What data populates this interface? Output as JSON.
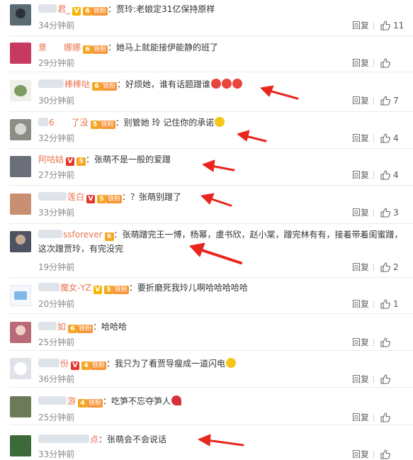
{
  "actions": {
    "reply_label": "回复"
  },
  "colors": {
    "username": "#eb7350",
    "arrow": "#e8261d",
    "time": "#8a8a8a"
  },
  "comments": [
    {
      "username": "君_",
      "badge": "gold",
      "level": "6",
      "fan_badge": "铁粉",
      "text": "：贾玲:老娘定31亿保持原样",
      "time": "34分钟前",
      "likes": "11",
      "avatar_color": "#5c6a73"
    },
    {
      "username": "意　　娜娜",
      "badge": "",
      "level": "6",
      "fan_badge": "铁粉",
      "text": "：她马上就能接伊能静的班了",
      "time": "29分钟前",
      "likes": "",
      "avatar_color": "#c63a62"
    },
    {
      "username": "棒棒哒",
      "badge": "",
      "level": "6",
      "fan_badge": "铁粉",
      "text": "：好烦她，谁有话题蹭谁",
      "time": "30分钟前",
      "likes": "7",
      "avatar_color": "#7f9a62",
      "emoji": [
        "angry-face-icon",
        "angry-face-icon",
        "angry-face-icon"
      ]
    },
    {
      "username": "6　　了没",
      "badge": "",
      "level": "5",
      "fan_badge": "铁粉",
      "text": "：别管她  玲  记住你的承诺",
      "time": "32分钟前",
      "likes": "4",
      "avatar_color": "#8c8d86",
      "emoji": [
        "cool-face-icon"
      ]
    },
    {
      "username": "阿咕姑",
      "badge": "red",
      "level": "5",
      "fan_badge": "",
      "text": "：张萌不是一般的爱蹭",
      "time": "27分钟前",
      "likes": "4",
      "avatar_color": "#6a6f7a"
    },
    {
      "username": "莲白",
      "badge": "red",
      "level": "5",
      "fan_badge": "铁粉",
      "text": "：？张萌别蹭了",
      "time": "33分钟前",
      "likes": "3",
      "avatar_color": "#c98f72"
    },
    {
      "username": "ssforever",
      "badge": "",
      "level": "6",
      "fan_badge": "",
      "text": "：张萌蹭完王一博，杨幂，虞书欣，赵小棠，蹭完林有有，接着带着闺蜜蹭，这次蹭贾玲，有完没完",
      "time": "19分钟前",
      "likes": "2",
      "avatar_color": "#4d5360"
    },
    {
      "username": "魔女-YZ",
      "badge": "gold",
      "level": "5",
      "fan_badge": "铁粉",
      "text": "：要折磨死我玲儿啊哈哈哈哈哈",
      "time": "20分钟前",
      "likes": "1",
      "avatar_color": "#7fb8e8"
    },
    {
      "username": "如",
      "badge": "",
      "level": "6",
      "fan_badge": "铁粉",
      "text": "：哈哈哈",
      "time": "25分钟前",
      "likes": "",
      "avatar_color": "#b86a78"
    },
    {
      "username": "份",
      "badge": "red",
      "level": "4",
      "fan_badge": "铁粉",
      "text": "：我只为了看贾导瘦成一道闪电",
      "time": "36分钟前",
      "likes": "",
      "avatar_color": "#dfe2e6",
      "emoji": [
        "laughing-face-icon"
      ]
    },
    {
      "username": "游",
      "badge": "",
      "level": "4",
      "fan_badge": "铁粉",
      "text": "：吃笋不忘夺笋人",
      "time": "25分钟前",
      "likes": "",
      "avatar_color": "#6b7b5a",
      "emoji": [
        "rose-icon"
      ]
    },
    {
      "username": "点",
      "badge": "",
      "level": "",
      "fan_badge": "",
      "text": "：张萌会不会说话",
      "time": "33分钟前",
      "likes": "",
      "avatar_color": "#3d6a3a"
    }
  ]
}
